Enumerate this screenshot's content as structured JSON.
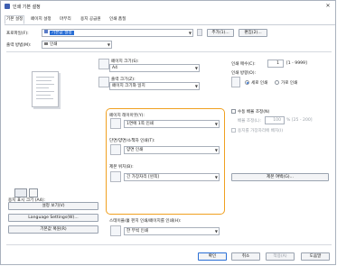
{
  "window": {
    "title": "인쇄 기본 설정",
    "close_glyph": "✕"
  },
  "tabs": [
    "기본 설정",
    "페이지 설정",
    "마무리",
    "용지 공급원",
    "인쇄 품질"
  ],
  "profile": {
    "label": "프로파일(F):",
    "value": "기본값 설정",
    "add_label": "추가(1)...",
    "edit_label": "편집(2)..."
  },
  "output": {
    "label": "출력 방법(M):",
    "value": "인쇄"
  },
  "page_size": {
    "label": "페이지 크기(S):",
    "value": "A4"
  },
  "output_size": {
    "label": "출력 크기(Z):",
    "value": "페이지 크기와 일치"
  },
  "copies": {
    "label": "인쇄 매수(C):",
    "value": "1",
    "range": "[1 - 9999]"
  },
  "orientation": {
    "label": "인쇄 방향(O):",
    "portrait": "세로 인쇄",
    "landscape": "가로 인쇄"
  },
  "layout": {
    "label": "페이지 레이아웃(Y):",
    "value": "1면에 1쪽 인쇄"
  },
  "duplex": {
    "label": "단면/양면/소책자 인쇄(T):",
    "value": "양면 인쇄"
  },
  "binding": {
    "label": "제본 위치(B):",
    "value": "긴 가장자리 [왼쪽]",
    "margin_btn": "제본 여백(G)..."
  },
  "manual_scale": {
    "label": "수동 배율 조정(N)",
    "scale_label": "배율 조정(L):",
    "scale_value": "100",
    "scale_range": "% [25 - 200]",
    "paper_check": "용지를 가장자리에 배치(I)"
  },
  "stapler": {
    "label": "스테이플/홀 펀치 인쇄/페이지를 인쇄(H):",
    "value": "한 부씩 인쇄"
  },
  "view_settings": {
    "label": "용지 표시 크기 (A4):"
  },
  "left_buttons": [
    "설정 보기(V)",
    "Language Settings(W)...",
    "기본값 복원(R)"
  ],
  "bottom_buttons": [
    "확인",
    "취소",
    "적용(A)",
    "도움말"
  ]
}
